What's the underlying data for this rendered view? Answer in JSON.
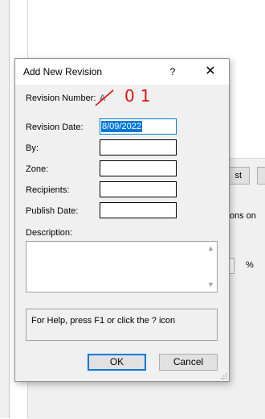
{
  "background": {
    "button_text": "st",
    "revisions_text": "visions on",
    "percent": "%"
  },
  "dialog": {
    "title": "Add New Revision",
    "help_glyph": "?",
    "close_glyph": "✕",
    "revision_number_label": "Revision Number:",
    "revision_number_value": "A",
    "annotation": "01",
    "annotation_color": "#e01010",
    "fields": {
      "revision_date": {
        "label": "Revision Date:",
        "value": "8/09/2022"
      },
      "by": {
        "label": "By:",
        "value": ""
      },
      "zone": {
        "label": "Zone:",
        "value": ""
      },
      "recipients": {
        "label": "Recipients:",
        "value": ""
      },
      "publish_date": {
        "label": "Publish Date:",
        "value": ""
      }
    },
    "description_label": "Description:",
    "description_value": "",
    "help_text": "For Help, press F1 or click the ? icon",
    "ok_label": "OK",
    "cancel_label": "Cancel"
  },
  "colors": {
    "accent": "#0078d7",
    "dialog_bg": "#f0f0f0"
  },
  "icons": [
    "help-icon",
    "close-icon",
    "scroll-up-icon",
    "scroll-down-icon",
    "resize-grip-icon"
  ]
}
